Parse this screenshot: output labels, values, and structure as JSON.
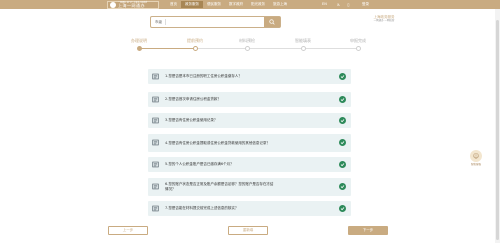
{
  "header": {
    "logo_small": "一网通办 总门户 上海市人民政府",
    "logo_big": "上海一网通办",
    "nav_items": [
      "首页",
      "政务服务",
      "便民服务",
      "数字政府",
      "阳光政务",
      "旅游上海"
    ],
    "active_nav": 1,
    "lang": "EN",
    "login": "登录"
  },
  "search": {
    "location": "市级",
    "placeholder": ""
  },
  "brand_right": {
    "line1": "上海政务服务",
    "line2": "一网通办 一网统管"
  },
  "steps": [
    {
      "label": "办理说明",
      "status": "done"
    },
    {
      "label": "提前预约",
      "status": "current"
    },
    {
      "label": "材料预检",
      "status": "pending"
    },
    {
      "label": "智能填表",
      "status": "pending"
    },
    {
      "label": "申报完成",
      "status": "pending"
    }
  ],
  "questions": [
    {
      "text": "1.您是否是本市已注册的职工住房公积金缴存人？"
    },
    {
      "text": "2.您是否首次申请住房公积金贷款？"
    },
    {
      "text": "3.您是否有住房公积金使用记录？"
    },
    {
      "text": "4.您是否有住房公积金提取或住房公积金贷款使用的其他信息记录？"
    },
    {
      "text": "5.您的个人公积金账户是否已缴存满6个月？"
    },
    {
      "text": "6.您的账户状态是否正常及账户余额是否足够？您的账户是否存在冻结情况？"
    },
    {
      "text": "7.您是否能在材料提交前完成上述信息的核实？"
    }
  ],
  "buttons": {
    "prev": "上一步",
    "reset": "重新填",
    "next": "下一步"
  },
  "helper": {
    "label": "智能客服"
  },
  "colors": {
    "brand": "#c9ab81",
    "check": "#2d8a5a",
    "question_bg": "#eaf2f3"
  }
}
